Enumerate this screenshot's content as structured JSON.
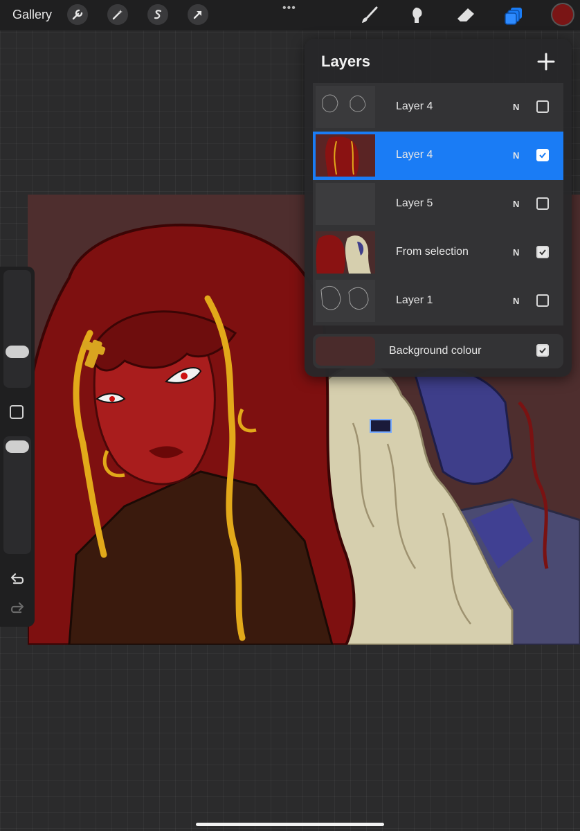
{
  "toolbar": {
    "gallery_label": "Gallery",
    "left_tools": [
      "wrench-icon",
      "magic-wand-icon",
      "selection-icon",
      "transform-arrow-icon"
    ],
    "right_tools": [
      "brush-icon",
      "smudge-icon",
      "eraser-icon",
      "layers-icon"
    ],
    "more_label": "•••",
    "current_color": "#7a1515"
  },
  "layers_panel": {
    "title": "Layers",
    "add_label": "+",
    "layers": [
      {
        "name": "Layer 4",
        "blend": "N",
        "visible": false,
        "selected": false
      },
      {
        "name": "Layer 4",
        "blend": "N",
        "visible": true,
        "selected": true
      },
      {
        "name": "Layer 5",
        "blend": "N",
        "visible": false,
        "selected": false
      },
      {
        "name": "From selection",
        "blend": "N",
        "visible": true,
        "selected": false
      },
      {
        "name": "Layer 1",
        "blend": "N",
        "visible": false,
        "selected": false
      }
    ],
    "background": {
      "name": "Background colour",
      "visible": true,
      "color": "#4a2b2b"
    }
  },
  "colors": {
    "accent": "#1a7cf5",
    "panel": "#28282a"
  }
}
